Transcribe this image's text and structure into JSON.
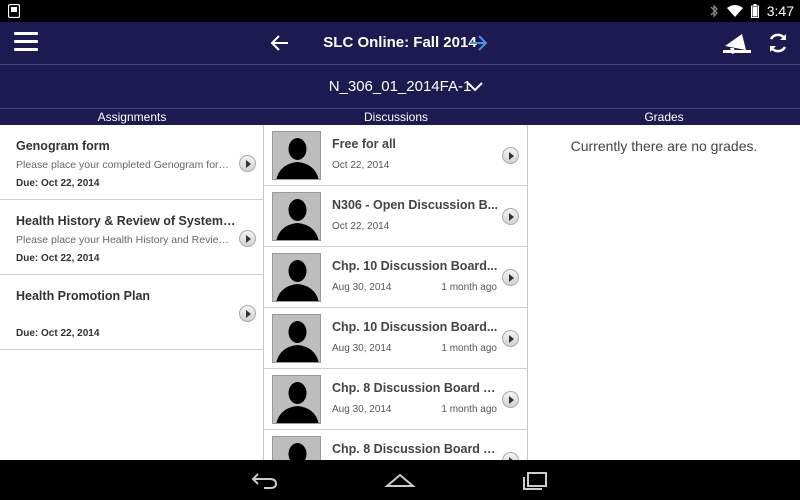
{
  "status_bar": {
    "time": "3:47",
    "icons": [
      "android-notification-icon",
      "bluetooth-icon",
      "wifi-icon",
      "battery-icon"
    ]
  },
  "app_bar": {
    "title": "SLC Online: Fall 2014",
    "icons": [
      "menu-icon",
      "back-arrow-icon",
      "forward-arrow-icon",
      "megaphone-icon",
      "refresh-icon"
    ],
    "forward_arrow_color": "#4a90e2"
  },
  "course": {
    "selected": "N_306_01_2014FA-1"
  },
  "columns": {
    "assignments": "Assignments",
    "discussions": "Discussions",
    "grades": "Grades"
  },
  "assignments": [
    {
      "title": "Genogram form",
      "description": "Please place your completed Genogram form in...",
      "due": "Due: Oct 22, 2014"
    },
    {
      "title": "Health History & Review of Systems f...",
      "description": "Please place your Health History and Review of...",
      "due": "Due: Oct 22, 2014"
    },
    {
      "title": "Health Promotion Plan",
      "description": "",
      "due": "Due: Oct 22, 2014"
    }
  ],
  "discussions": [
    {
      "title": "Free for all",
      "date": "Oct 22, 2014",
      "ago": ""
    },
    {
      "title": "N306 - Open Discussion B...",
      "date": "Oct 22, 2014",
      "ago": ""
    },
    {
      "title": "Chp. 10 Discussion Board...",
      "date": "Aug 30, 2014",
      "ago": "1 month ago"
    },
    {
      "title": "Chp. 10 Discussion Board...",
      "date": "Aug 30, 2014",
      "ago": "1 month ago"
    },
    {
      "title": "Chp. 8 Discussion Board A...",
      "date": "Aug 30, 2014",
      "ago": "1 month ago"
    },
    {
      "title": "Chp. 8 Discussion Board A...",
      "date": "",
      "ago": ""
    }
  ],
  "grades": {
    "empty_message": "Currently there are no grades."
  },
  "colors": {
    "header_bg": "#1c1a50",
    "text_dark": "#333333"
  }
}
